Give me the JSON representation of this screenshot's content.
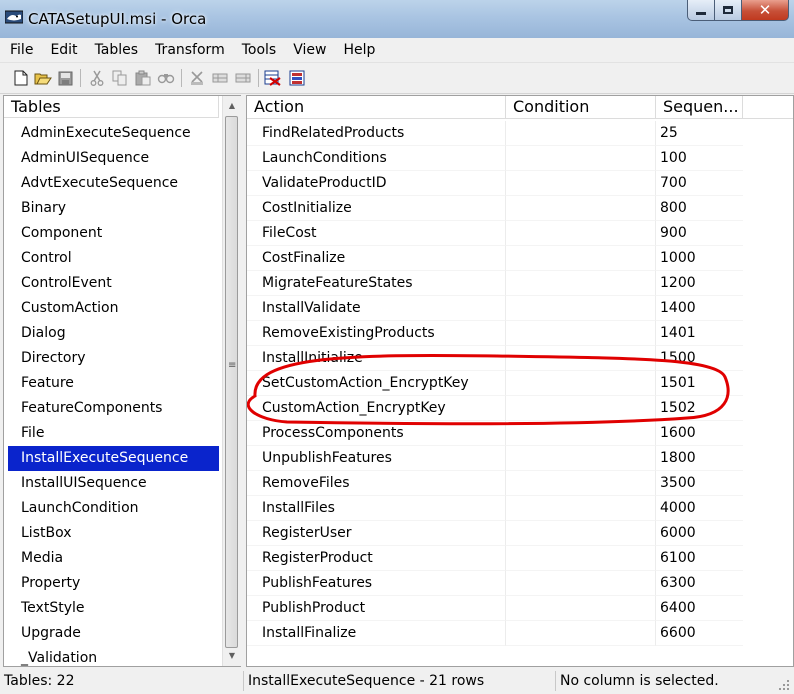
{
  "window": {
    "title": "CATASetupUI.msi - Orca",
    "buttons": {
      "minimize": "▬",
      "maximize": "□",
      "close": "✕"
    }
  },
  "menu": [
    "File",
    "Edit",
    "Tables",
    "Transform",
    "Tools",
    "View",
    "Help"
  ],
  "toolbar_icons": [
    "new-file-icon",
    "open-folder-icon",
    "save-icon",
    "cut-icon",
    "copy-icon",
    "paste-icon",
    "find-icon",
    "add-table-icon",
    "drop-table-icon",
    "add-row-icon",
    "validate-icon",
    "merge-module-icon"
  ],
  "tables_pane": {
    "header": "Tables",
    "items": [
      "AdminExecuteSequence",
      "AdminUISequence",
      "AdvtExecuteSequence",
      "Binary",
      "Component",
      "Control",
      "ControlEvent",
      "CustomAction",
      "Dialog",
      "Directory",
      "Feature",
      "FeatureComponents",
      "File",
      "InstallExecuteSequence",
      "InstallUISequence",
      "LaunchCondition",
      "ListBox",
      "Media",
      "Property",
      "TextStyle",
      "Upgrade",
      "_Validation"
    ],
    "selected": "InstallExecuteSequence"
  },
  "grid": {
    "headers": {
      "action": "Action",
      "condition": "Condition",
      "sequence": "Sequen..."
    },
    "rows": [
      {
        "action": "FindRelatedProducts",
        "condition": "",
        "sequence": "25"
      },
      {
        "action": "LaunchConditions",
        "condition": "",
        "sequence": "100"
      },
      {
        "action": "ValidateProductID",
        "condition": "",
        "sequence": "700"
      },
      {
        "action": "CostInitialize",
        "condition": "",
        "sequence": "800"
      },
      {
        "action": "FileCost",
        "condition": "",
        "sequence": "900"
      },
      {
        "action": "CostFinalize",
        "condition": "",
        "sequence": "1000"
      },
      {
        "action": "MigrateFeatureStates",
        "condition": "",
        "sequence": "1200"
      },
      {
        "action": "InstallValidate",
        "condition": "",
        "sequence": "1400"
      },
      {
        "action": "RemoveExistingProducts",
        "condition": "",
        "sequence": "1401"
      },
      {
        "action": "InstallInitialize",
        "condition": "",
        "sequence": "1500"
      },
      {
        "action": "SetCustomAction_EncryptKey",
        "condition": "",
        "sequence": "1501"
      },
      {
        "action": "CustomAction_EncryptKey",
        "condition": "",
        "sequence": "1502"
      },
      {
        "action": "ProcessComponents",
        "condition": "",
        "sequence": "1600"
      },
      {
        "action": "UnpublishFeatures",
        "condition": "",
        "sequence": "1800"
      },
      {
        "action": "RemoveFiles",
        "condition": "",
        "sequence": "3500"
      },
      {
        "action": "InstallFiles",
        "condition": "",
        "sequence": "4000"
      },
      {
        "action": "RegisterUser",
        "condition": "",
        "sequence": "6000"
      },
      {
        "action": "RegisterProduct",
        "condition": "",
        "sequence": "6100"
      },
      {
        "action": "PublishFeatures",
        "condition": "",
        "sequence": "6300"
      },
      {
        "action": "PublishProduct",
        "condition": "",
        "sequence": "6400"
      },
      {
        "action": "InstallFinalize",
        "condition": "",
        "sequence": "6600"
      }
    ],
    "highlight_color": "#e00000"
  },
  "status": {
    "tables_count": "Tables: 22",
    "table_info": "InstallExecuteSequence - 21 rows",
    "column_info": "No column is selected."
  },
  "colors": {
    "selection": "#0a24cc",
    "annotation": "#e00000"
  }
}
